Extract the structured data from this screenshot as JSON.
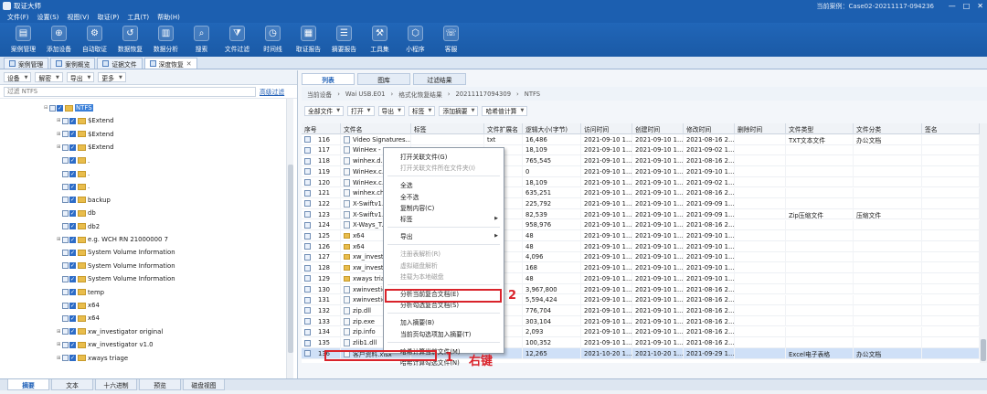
{
  "window": {
    "title": "取证大师",
    "case": "当前案例：Case02-20211117-094236",
    "min": "—",
    "max": "□",
    "close": "✕"
  },
  "menu": [
    "文件(F)",
    "设置(S)",
    "视图(V)",
    "取证(P)",
    "工具(T)",
    "帮助(H)"
  ],
  "toolbar": [
    {
      "label": "案例管理",
      "icon": "case-icon"
    },
    {
      "label": "添加设备",
      "icon": "add-device-icon"
    },
    {
      "label": "自动取证",
      "icon": "auto-forensics-icon"
    },
    {
      "label": "数据恢复",
      "icon": "recover-icon"
    },
    {
      "label": "数据分析",
      "icon": "analysis-icon"
    },
    {
      "label": "搜索",
      "icon": "search-icon"
    },
    {
      "label": "文件过滤",
      "icon": "filter-icon"
    },
    {
      "label": "时间线",
      "icon": "timeline-icon"
    },
    {
      "label": "取证报告",
      "icon": "report-icon"
    },
    {
      "label": "摘要报告",
      "icon": "summary-icon"
    },
    {
      "label": "工具集",
      "icon": "toolset-icon"
    },
    {
      "label": "小程序",
      "icon": "miniapp-icon"
    },
    {
      "label": "客服",
      "icon": "support-icon"
    }
  ],
  "doc_tabs": [
    {
      "label": "案例管理",
      "active": false
    },
    {
      "label": "案例概览",
      "active": false
    },
    {
      "label": "证据文件",
      "active": false
    },
    {
      "label": "深度恢复",
      "active": true
    }
  ],
  "left": {
    "toolbar": [
      "设备",
      "解密",
      "导出",
      "更多"
    ],
    "filter_placeholder": "过滤 NTFS",
    "advanced_filter": "高级过滤",
    "tree": [
      {
        "label": "NTFS",
        "level": 0,
        "selected": true,
        "expander": "⊟"
      },
      {
        "label": "$Extend",
        "level": 1,
        "expander": "⊞"
      },
      {
        "label": "$Extend",
        "level": 1,
        "expander": "⊞"
      },
      {
        "label": "$Extend",
        "level": 1,
        "expander": "⊞"
      },
      {
        "label": ".",
        "level": 1,
        "expander": ""
      },
      {
        "label": ".",
        "level": 1,
        "expander": ""
      },
      {
        "label": ".",
        "level": 1,
        "expander": ""
      },
      {
        "label": "backup",
        "level": 1,
        "expander": ""
      },
      {
        "label": "db",
        "level": 1,
        "expander": ""
      },
      {
        "label": "db2",
        "level": 1,
        "expander": ""
      },
      {
        "label": "e.g. WCH RN 21000000 7",
        "level": 1,
        "expander": "⊞"
      },
      {
        "label": "System Volume Information",
        "level": 1,
        "expander": ""
      },
      {
        "label": "System Volume Information",
        "level": 1,
        "expander": ""
      },
      {
        "label": "System Volume Information",
        "level": 1,
        "expander": ""
      },
      {
        "label": "temp",
        "level": 1,
        "expander": ""
      },
      {
        "label": "x64",
        "level": 1,
        "expander": ""
      },
      {
        "label": "x64",
        "level": 1,
        "expander": ""
      },
      {
        "label": "xw_investigator original",
        "level": 1,
        "expander": "⊞"
      },
      {
        "label": "xw_investigator v1.0",
        "level": 1,
        "expander": "⊞"
      },
      {
        "label": "xways triage",
        "level": 1,
        "expander": "⊞"
      }
    ]
  },
  "right": {
    "tabs": [
      {
        "label": "列表",
        "active": true
      },
      {
        "label": "图库",
        "active": false
      },
      {
        "label": "过滤结果",
        "active": false
      }
    ],
    "breadcrumb": [
      "当前设备",
      "Wai USB.E01",
      "格式化恢复结果",
      "20211117094309",
      "NTFS"
    ],
    "toolbar": [
      "全部文件",
      "打开",
      "导出",
      "标签",
      "添加摘要",
      "哈希值计算"
    ],
    "columns": [
      "序号",
      "文件名",
      "标签",
      "文件扩展名",
      "逻辑大小(字节)",
      "访问时间",
      "创建时间",
      "修改时间",
      "删除时间",
      "文件类型",
      "文件分类",
      "签名"
    ],
    "rows": [
      {
        "no": "116",
        "name": "Video Signatures...",
        "ext": "txt",
        "size": "16,486",
        "atime": "2021-09-10 1...",
        "ctime": "2021-09-10 1...",
        "mtime": "2021-08-16 2...",
        "type": "TXT文本文件",
        "cat": "办公文档",
        "folder": false
      },
      {
        "no": "117",
        "name": "WinHex -",
        "ext": "",
        "size": "18,109",
        "atime": "2021-09-10 1...",
        "ctime": "2021-09-10 1...",
        "mtime": "2021-09-02 1...",
        "type": "",
        "cat": "",
        "folder": false
      },
      {
        "no": "118",
        "name": "winhex.d...",
        "ext": "",
        "size": "765,545",
        "atime": "2021-09-10 1...",
        "ctime": "2021-09-10 1...",
        "mtime": "2021-08-16 2...",
        "type": "",
        "cat": "",
        "folder": false
      },
      {
        "no": "119",
        "name": "WinHex.c...",
        "ext": "",
        "size": "0",
        "atime": "2021-09-10 1...",
        "ctime": "2021-09-10 1...",
        "mtime": "2021-09-10 1...",
        "type": "",
        "cat": "",
        "folder": false
      },
      {
        "no": "120",
        "name": "WinHex.c...",
        "ext": "",
        "size": "18,109",
        "atime": "2021-09-10 1...",
        "ctime": "2021-09-10 1...",
        "mtime": "2021-09-02 1...",
        "type": "",
        "cat": "",
        "folder": false
      },
      {
        "no": "121",
        "name": "winhex.ch...",
        "ext": "",
        "size": "635,251",
        "atime": "2021-09-10 1...",
        "ctime": "2021-09-10 1...",
        "mtime": "2021-08-16 2...",
        "type": "",
        "cat": "",
        "folder": false
      },
      {
        "no": "122",
        "name": "X-Swiftv1...",
        "ext": "",
        "size": "225,792",
        "atime": "2021-09-10 1...",
        "ctime": "2021-09-10 1...",
        "mtime": "2021-09-09 1...",
        "type": "",
        "cat": "",
        "folder": false
      },
      {
        "no": "123",
        "name": "X-Swiftv1...",
        "ext": "",
        "size": "82,539",
        "atime": "2021-09-10 1...",
        "ctime": "2021-09-10 1...",
        "mtime": "2021-09-09 1...",
        "type": "Zip压缩文件",
        "cat": "压缩文件",
        "folder": false
      },
      {
        "no": "124",
        "name": "X-Ways_T...",
        "ext": "",
        "size": "958,976",
        "atime": "2021-09-10 1...",
        "ctime": "2021-09-10 1...",
        "mtime": "2021-08-16 2...",
        "type": "",
        "cat": "",
        "folder": false
      },
      {
        "no": "125",
        "name": "x64",
        "ext": "",
        "size": "48",
        "atime": "2021-09-10 1...",
        "ctime": "2021-09-10 1...",
        "mtime": "2021-09-10 1...",
        "type": "",
        "cat": "",
        "folder": true
      },
      {
        "no": "126",
        "name": "x64",
        "ext": "",
        "size": "48",
        "atime": "2021-09-10 1...",
        "ctime": "2021-09-10 1...",
        "mtime": "2021-09-10 1...",
        "type": "",
        "cat": "",
        "folder": true
      },
      {
        "no": "127",
        "name": "xw_investi...",
        "ext": "",
        "size": "4,096",
        "atime": "2021-09-10 1...",
        "ctime": "2021-09-10 1...",
        "mtime": "2021-09-10 1...",
        "type": "",
        "cat": "",
        "folder": true
      },
      {
        "no": "128",
        "name": "xw_investi...",
        "ext": "",
        "size": "168",
        "atime": "2021-09-10 1...",
        "ctime": "2021-09-10 1...",
        "mtime": "2021-09-10 1...",
        "type": "",
        "cat": "",
        "folder": true
      },
      {
        "no": "129",
        "name": "xways tria...",
        "ext": "",
        "size": "48",
        "atime": "2021-09-10 1...",
        "ctime": "2021-09-10 1...",
        "mtime": "2021-09-10 1...",
        "type": "",
        "cat": "",
        "folder": true
      },
      {
        "no": "130",
        "name": "xwinvestic...",
        "ext": "",
        "size": "3,967,800",
        "atime": "2021-09-10 1...",
        "ctime": "2021-09-10 1...",
        "mtime": "2021-08-16 2...",
        "type": "",
        "cat": "",
        "folder": false
      },
      {
        "no": "131",
        "name": "xwinvestic...",
        "ext": "",
        "size": "5,594,424",
        "atime": "2021-09-10 1...",
        "ctime": "2021-09-10 1...",
        "mtime": "2021-08-16 2...",
        "type": "",
        "cat": "",
        "folder": false
      },
      {
        "no": "132",
        "name": "zip.dll",
        "ext": "",
        "size": "776,704",
        "atime": "2021-09-10 1...",
        "ctime": "2021-09-10 1...",
        "mtime": "2021-08-16 2...",
        "type": "",
        "cat": "",
        "folder": false
      },
      {
        "no": "133",
        "name": "zip.exe",
        "ext": "",
        "size": "303,104",
        "atime": "2021-09-10 1...",
        "ctime": "2021-09-10 1...",
        "mtime": "2021-08-16 2...",
        "type": "",
        "cat": "",
        "folder": false
      },
      {
        "no": "134",
        "name": "zip.info",
        "ext": "",
        "size": "2,093",
        "atime": "2021-09-10 1...",
        "ctime": "2021-09-10 1...",
        "mtime": "2021-08-16 2...",
        "type": "",
        "cat": "",
        "folder": false
      },
      {
        "no": "135",
        "name": "zlib1.dll",
        "ext": "",
        "size": "100,352",
        "atime": "2021-09-10 1...",
        "ctime": "2021-09-10 1...",
        "mtime": "2021-08-16 2...",
        "type": "",
        "cat": "",
        "folder": false
      },
      {
        "no": "136",
        "name": "客户资料.xlsx",
        "ext": "",
        "size": "12,265",
        "atime": "2021-10-20 1...",
        "ctime": "2021-10-20 1...",
        "mtime": "2021-09-29 1...",
        "type": "Excel电子表格",
        "cat": "办公文档",
        "folder": false,
        "highlight": true
      }
    ]
  },
  "context_menu": [
    {
      "label": "打开关联文件(G)",
      "disabled": false
    },
    {
      "label": "打开关联文件所在文件夹(I)",
      "disabled": true
    },
    {
      "sep": true
    },
    {
      "label": "全选",
      "disabled": false
    },
    {
      "label": "全不选",
      "disabled": false
    },
    {
      "label": "复制内容(C)",
      "disabled": false
    },
    {
      "label": "标签",
      "disabled": false,
      "submenu": true
    },
    {
      "sep": true
    },
    {
      "label": "导出",
      "disabled": false,
      "submenu": true
    },
    {
      "sep": true
    },
    {
      "label": "注册表解析(R)",
      "disabled": true
    },
    {
      "label": "虚拟磁盘解析",
      "disabled": true
    },
    {
      "label": "挂载为本地磁盘",
      "disabled": true
    },
    {
      "sep": true
    },
    {
      "label": "分析当前复合文档(E)",
      "disabled": false
    },
    {
      "label": "分析勾选复合文档(S)",
      "disabled": false,
      "annotated": true
    },
    {
      "sep": true
    },
    {
      "label": "加入摘要(B)",
      "disabled": false
    },
    {
      "label": "当前页勾选项加入摘要(T)",
      "disabled": false
    },
    {
      "sep": true
    },
    {
      "label": "哈希计算当前文件(M)",
      "disabled": false
    },
    {
      "label": "哈希计算勾选文件(N)",
      "disabled": false
    }
  ],
  "annotations": {
    "step1": "1",
    "step1_text": "右键",
    "step2": "2"
  },
  "bottom_tabs": [
    {
      "label": "摘要",
      "active": true
    },
    {
      "label": "文本",
      "active": false
    },
    {
      "label": "十六进制",
      "active": false
    },
    {
      "label": "预览",
      "active": false
    },
    {
      "label": "磁盘视图",
      "active": false
    }
  ],
  "colors": {
    "titlebar": "#1c5fb0",
    "selection": "#cfe0f7",
    "annotation": "#d9232b"
  }
}
